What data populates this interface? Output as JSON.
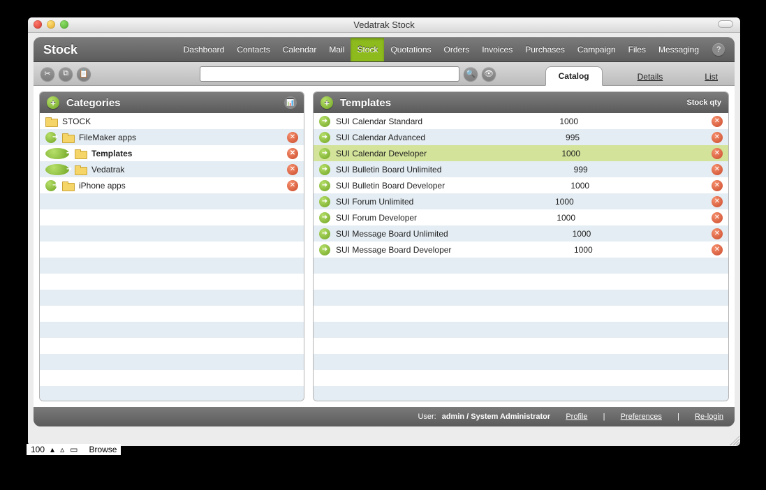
{
  "window": {
    "title": "Vedatrak Stock"
  },
  "header": {
    "title": "Stock",
    "nav": [
      "Dashboard",
      "Contacts",
      "Calendar",
      "Mail",
      "Stock",
      "Quotations",
      "Orders",
      "Invoices",
      "Purchases",
      "Campaign",
      "Files",
      "Messaging"
    ],
    "active": "Stock",
    "help": "?"
  },
  "toolbar": {
    "search_placeholder": "",
    "subtabs": [
      "Catalog",
      "Details",
      "List"
    ],
    "active_subtab": "Catalog"
  },
  "categories": {
    "title": "Categories",
    "items": [
      {
        "label": "STOCK",
        "indent": 0,
        "arrow": false,
        "del": false,
        "open": true
      },
      {
        "label": "FileMaker apps",
        "indent": 1,
        "arrow": true,
        "del": true,
        "open": true
      },
      {
        "label": "Templates",
        "indent": 2,
        "arrow": true,
        "del": true,
        "selected": true
      },
      {
        "label": "Vedatrak",
        "indent": 2,
        "arrow": true,
        "del": true
      },
      {
        "label": "iPhone apps",
        "indent": 1,
        "arrow": true,
        "del": true
      }
    ]
  },
  "templates": {
    "title": "Templates",
    "qty_header": "Stock qty",
    "items": [
      {
        "label": "SUI Calendar Standard",
        "qty": "1000"
      },
      {
        "label": "SUI Calendar Advanced",
        "qty": "995"
      },
      {
        "label": "SUI Calendar Developer",
        "qty": "1000",
        "selected": true
      },
      {
        "label": "SUI Bulletin Board Unlimited",
        "qty": "999"
      },
      {
        "label": "SUI Bulletin Board Developer",
        "qty": "1000"
      },
      {
        "label": "SUI Forum Unlimited",
        "qty": "1000"
      },
      {
        "label": "SUI Forum Developer",
        "qty": "1000"
      },
      {
        "label": "SUI Message Board Unlimited",
        "qty": "1000"
      },
      {
        "label": "SUI Message Board Developer",
        "qty": "1000"
      }
    ]
  },
  "status": {
    "user_label": "User: ",
    "user": "admin / System Administrator",
    "profile": "Profile",
    "prefs": "Preferences",
    "relogin": "Re-login",
    "sep": "|"
  },
  "fm": {
    "count": "100",
    "mode": "Browse"
  }
}
